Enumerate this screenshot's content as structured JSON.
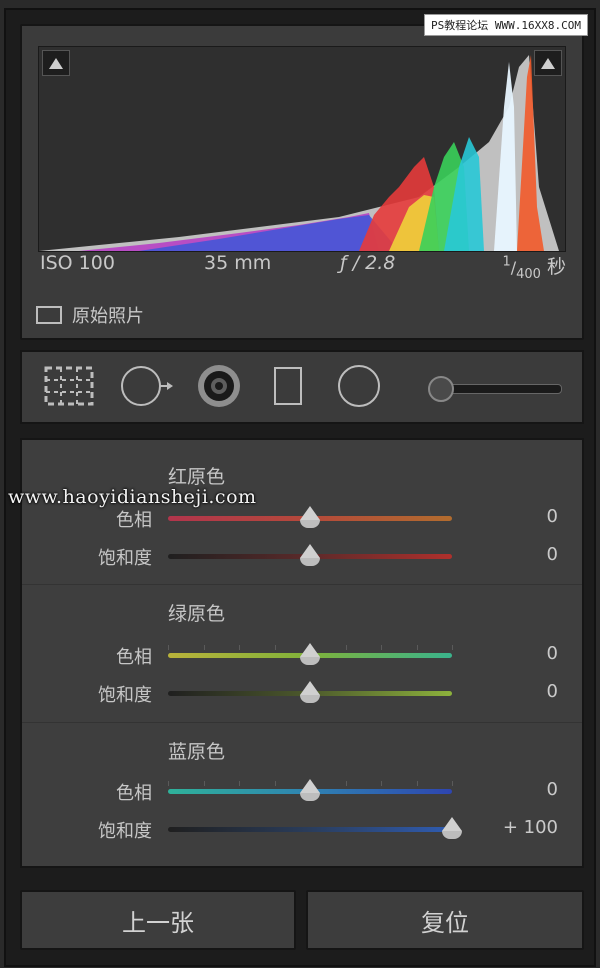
{
  "watermarks": {
    "top_right": "PS教程论坛 WWW.16XX8.COM",
    "middle": "www.haoyidiansheji.com"
  },
  "histogram": {
    "iso": "ISO 100",
    "focal_length": "35 mm",
    "aperture": "ƒ / 2.8",
    "shutter_num": "1",
    "shutter_den": "400",
    "shutter_unit": "秒",
    "original_photo_label": "原始照片"
  },
  "tools": {
    "icons": [
      "crop-grid-icon",
      "spot-removal-icon",
      "red-eye-icon",
      "graduated-filter-icon",
      "radial-filter-icon",
      "adjustment-brush-icon"
    ],
    "slider_value": 0
  },
  "hsl": {
    "sections": [
      {
        "title": "红原色",
        "rows": [
          {
            "label": "色相",
            "value": "0",
            "fraction": 0.5,
            "gradient": [
              "#b2354c",
              "#b4493a",
              "#b26c2e"
            ]
          },
          {
            "label": "饱和度",
            "value": "0",
            "fraction": 0.5,
            "gradient": [
              "#1f1f1f",
              "#5c2a2a",
              "#b0302c"
            ]
          }
        ]
      },
      {
        "title": "绿原色",
        "rows": [
          {
            "label": "色相",
            "value": "0",
            "fraction": 0.5,
            "gradient": [
              "#b9b23a",
              "#7fb23a",
              "#3ab38c"
            ]
          },
          {
            "label": "饱和度",
            "value": "0",
            "fraction": 0.5,
            "gradient": [
              "#1f1f1f",
              "#4d5a2c",
              "#8db23c"
            ]
          }
        ]
      },
      {
        "title": "蓝原色",
        "rows": [
          {
            "label": "色相",
            "value": "0",
            "fraction": 0.5,
            "gradient": [
              "#2fb29a",
              "#2f83b2",
              "#2e45b0"
            ]
          },
          {
            "label": "饱和度",
            "value": "+ 100",
            "fraction": 1.0,
            "gradient": [
              "#1f1f1f",
              "#2a3d5c",
              "#2f5cb2"
            ]
          }
        ]
      }
    ]
  },
  "buttons": {
    "previous": "上一张",
    "reset": "复位"
  },
  "colors": {
    "panel": "#3b3b3b",
    "background": "#1c1c1c",
    "text": "#c6c6c6"
  }
}
